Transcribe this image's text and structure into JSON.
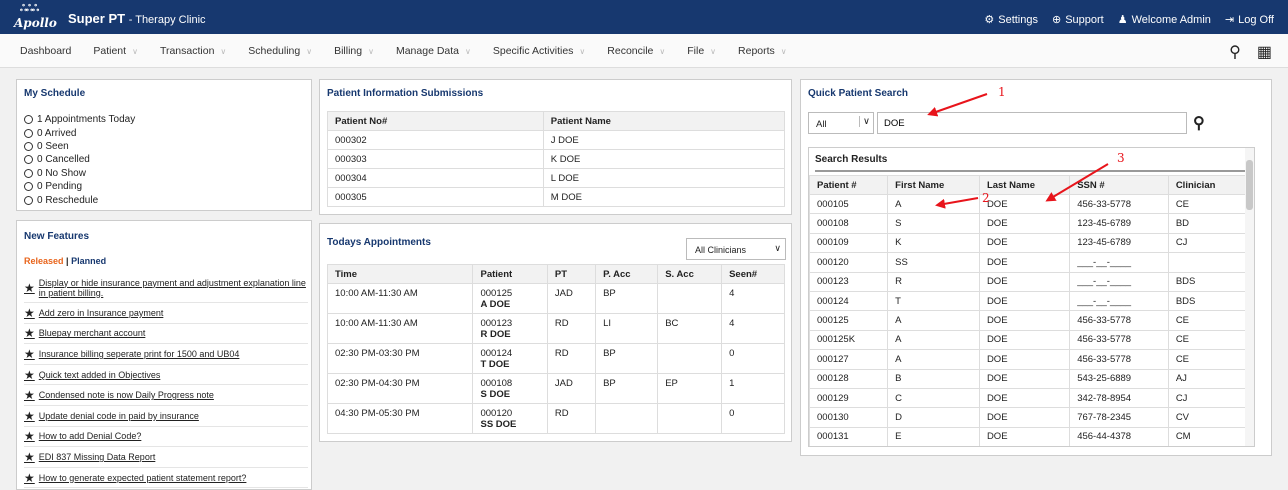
{
  "app": {
    "logo": "Apollo",
    "title": "Super PT",
    "subtitle": "- Therapy Clinic"
  },
  "toplinks": [
    {
      "icon": "gear-icon",
      "label": "Settings"
    },
    {
      "icon": "support-icon",
      "label": "Support"
    },
    {
      "icon": "user-icon",
      "label": "Welcome Admin"
    },
    {
      "icon": "logout-icon",
      "label": "Log Off"
    }
  ],
  "nav": [
    "Dashboard",
    "Patient",
    "Transaction",
    "Scheduling",
    "Billing",
    "Manage Data",
    "Specific Activities",
    "Reconcile",
    "File",
    "Reports"
  ],
  "schedule": {
    "title": "My Schedule",
    "items": [
      "1 Appointments Today",
      "0 Arrived",
      "0 Seen",
      "0 Cancelled",
      "0 No Show",
      "0 Pending",
      "0 Reschedule"
    ]
  },
  "features": {
    "title": "New Features",
    "released": "Released",
    "sep": "|",
    "planned": "Planned",
    "items": [
      "Display or hide insurance payment and adjustment explanation line in patient billing.",
      "Add zero in Insurance payment",
      "Bluepay merchant account",
      "Insurance billing seperate print for 1500 and UB04",
      "Quick text added in Objectives",
      "Condensed note is now Daily Progress note",
      "Update denial code in paid by insurance",
      "How to add Denial Code?",
      "EDI 837 Missing Data Report",
      "How to generate expected patient statement report?"
    ]
  },
  "submissions": {
    "title": "Patient Information Submissions",
    "headers": [
      "Patient No#",
      "Patient Name"
    ],
    "rows": [
      [
        "000302",
        "J DOE"
      ],
      [
        "000303",
        "K DOE"
      ],
      [
        "000304",
        "L DOE"
      ],
      [
        "000305",
        "M DOE"
      ]
    ]
  },
  "appointments": {
    "title": "Todays Appointments",
    "filter": "All Clinicians",
    "headers": [
      "Time",
      "Patient",
      "PT",
      "P. Acc",
      "S. Acc",
      "Seen#"
    ],
    "rows": [
      [
        "10:00 AM-11:30 AM",
        "000125",
        "A DOE",
        "JAD",
        "BP",
        "",
        "4"
      ],
      [
        "10:00 AM-11:30 AM",
        "000123",
        "R DOE",
        "RD",
        "LI",
        "BC",
        "4"
      ],
      [
        "02:30 PM-03:30 PM",
        "000124",
        "T DOE",
        "RD",
        "BP",
        "",
        "0"
      ],
      [
        "02:30 PM-04:30 PM",
        "000108",
        "S DOE",
        "JAD",
        "BP",
        "EP",
        "1"
      ],
      [
        "04:30 PM-05:30 PM",
        "000120",
        "SS DOE",
        "RD",
        "",
        "",
        "0"
      ]
    ]
  },
  "search": {
    "title": "Quick Patient Search",
    "scope": "All",
    "query": "DOE",
    "results_title": "Search Results",
    "headers": [
      "Patient #",
      "First Name",
      "Last Name",
      "SSN #",
      "Clinician"
    ],
    "rows": [
      [
        "000105",
        "A",
        "DOE",
        "456-33-5778",
        "CE"
      ],
      [
        "000108",
        "S",
        "DOE",
        "123-45-6789",
        "BD"
      ],
      [
        "000109",
        "K",
        "DOE",
        "123-45-6789",
        "CJ"
      ],
      [
        "000120",
        "SS",
        "DOE",
        "___-__-____",
        ""
      ],
      [
        "000123",
        "R",
        "DOE",
        "___-__-____",
        "BDS"
      ],
      [
        "000124",
        "T",
        "DOE",
        "___-__-____",
        "BDS"
      ],
      [
        "000125",
        "A",
        "DOE",
        "456-33-5778",
        "CE"
      ],
      [
        "000125K",
        "A",
        "DOE",
        "456-33-5778",
        "CE"
      ],
      [
        "000127",
        "A",
        "DOE",
        "456-33-5778",
        "CE"
      ],
      [
        "000128",
        "B",
        "DOE",
        "543-25-6889",
        "AJ"
      ],
      [
        "000129",
        "C",
        "DOE",
        "342-78-8954",
        "CJ"
      ],
      [
        "000130",
        "D",
        "DOE",
        "767-78-2345",
        "CV"
      ],
      [
        "000131",
        "E",
        "DOE",
        "456-44-4378",
        "CM"
      ]
    ]
  },
  "annotations": [
    "1",
    "2",
    "3"
  ],
  "colors": {
    "header": "#17386f",
    "released": "#e8641b",
    "arrow": "#e8141b"
  }
}
